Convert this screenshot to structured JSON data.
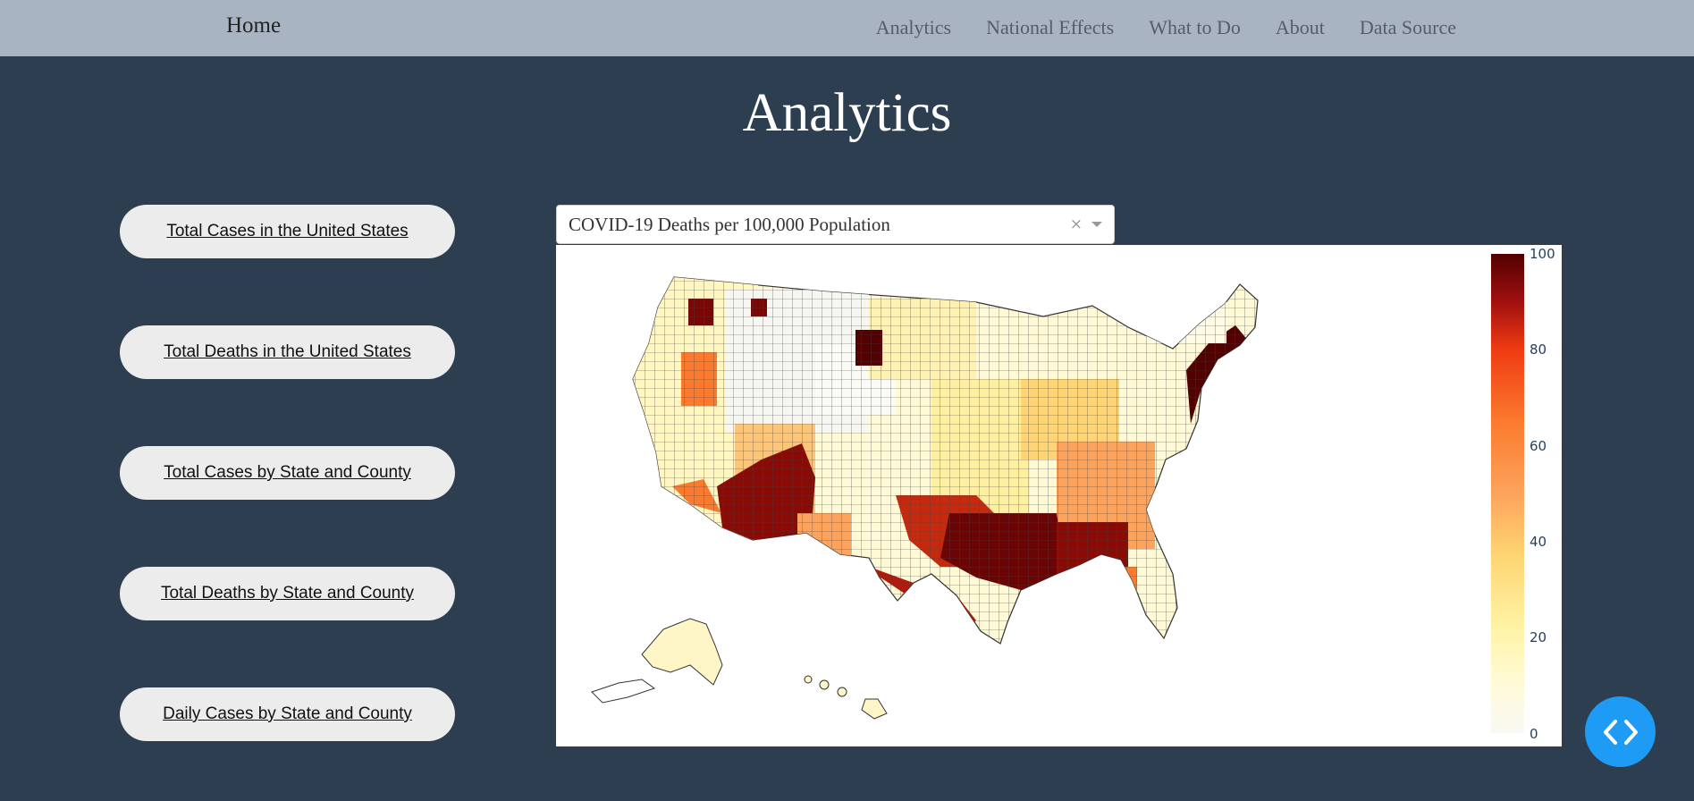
{
  "navbar": {
    "home": "Home",
    "links": [
      "Analytics",
      "National Effects",
      "What to Do",
      "About",
      "Data Source"
    ]
  },
  "page_title": "Analytics",
  "sidebar": {
    "buttons": [
      "Total Cases in the United States",
      "Total Deaths in the United States",
      "Total Cases by State and County",
      "Total Deaths by State and County",
      "Daily Cases by State and County"
    ]
  },
  "dropdown": {
    "selected": "COVID-19 Deaths per 100,000 Population",
    "clear_glyph": "×"
  },
  "colorbar": {
    "ticks": [
      "100",
      "80",
      "60",
      "40",
      "20",
      "0"
    ],
    "range": [
      0,
      100
    ],
    "colors": [
      "#f9f9f5",
      "#fffbd8",
      "#fff3a6",
      "#fed572",
      "#fda35c",
      "#fb7a2e",
      "#f03b12",
      "#a11010",
      "#520000"
    ]
  },
  "colors": {
    "background": "#2c3e50",
    "navbar": "#a9b4c2",
    "toggle_button": "#1e9bf5"
  },
  "code_toggle": {
    "icon": "code-brackets-icon"
  }
}
